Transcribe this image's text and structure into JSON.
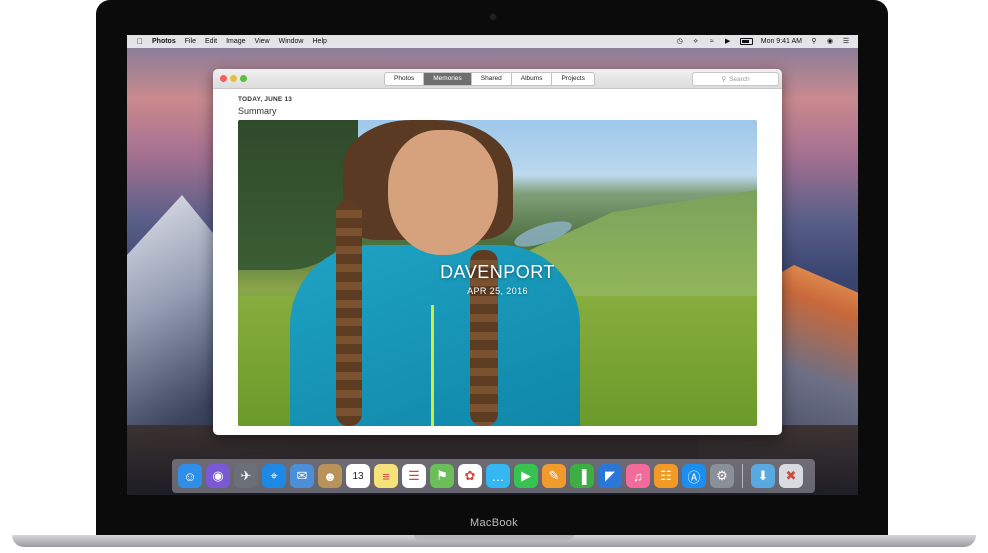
{
  "menubar": {
    "apple": "",
    "items": [
      "Photos",
      "File",
      "Edit",
      "Image",
      "View",
      "Window",
      "Help"
    ],
    "clock": "Mon 9:41 AM"
  },
  "window": {
    "tabs": [
      "Photos",
      "Memories",
      "Shared",
      "Albums",
      "Projects"
    ],
    "active_tab": "Memories",
    "search_placeholder": "Search",
    "date_label": "TODAY, JUNE 13",
    "section_title": "Summary",
    "memory_title": "DAVENPORT",
    "memory_date": "APR 25, 2016"
  },
  "dock": {
    "icons": [
      "finder-icon",
      "siri-icon",
      "launchpad-icon",
      "safari-icon",
      "mail-icon",
      "contacts-icon",
      "calendar-icon",
      "notes-icon",
      "reminders-icon",
      "maps-icon",
      "photos-icon",
      "messages-icon",
      "facetime-icon",
      "pages-icon",
      "numbers-icon",
      "keynote-icon",
      "itunes-icon",
      "ibooks-icon",
      "appstore-icon",
      "system-preferences-icon",
      "downloads-folder-icon",
      "trash-icon"
    ],
    "colors": [
      "#2f8fe8",
      "#7b58d6",
      "#6b6f78",
      "#1e88e5",
      "#4a8fd8",
      "#b9935a",
      "#ffffff",
      "#f6e27a",
      "#ffffff",
      "#6bbf59",
      "#ffffff",
      "#35b8f2",
      "#37c34f",
      "#f19b2c",
      "#3dae43",
      "#2a77d8",
      "#f46b9b",
      "#f39a26",
      "#1b8ef2",
      "#8b8f96",
      "#5aa9e0",
      "#d8dbe0"
    ],
    "calendar_day": "13"
  },
  "device_label": "MacBook"
}
